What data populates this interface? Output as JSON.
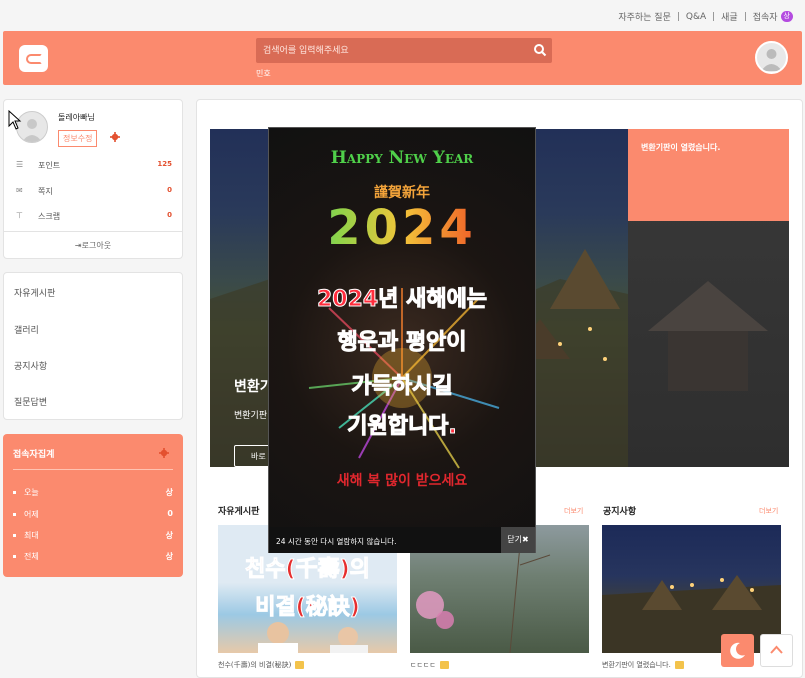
{
  "toplinks": {
    "faq": "자주하는 질문",
    "qa": "Q&A",
    "new": "새글",
    "visitors": "접속자",
    "visitors_badge": "상"
  },
  "header": {
    "search_placeholder": "검색어를 입력해주세요",
    "popular": "민호"
  },
  "profile": {
    "name": "돌레아빠님",
    "edit_label": "정보수정",
    "rows": [
      {
        "icon": "database-icon",
        "label": "포인트",
        "value": "125"
      },
      {
        "icon": "mail-icon",
        "label": "쪽지",
        "value": "0"
      },
      {
        "icon": "pin-icon",
        "label": "스크랩",
        "value": "0"
      }
    ],
    "logout": "로그아웃"
  },
  "menu": {
    "items": [
      "자유게시판",
      "갤러리",
      "공지사항",
      "질문답변"
    ]
  },
  "visitors": {
    "title": "접속자집계",
    "rows": [
      {
        "label": "오늘",
        "value": "상"
      },
      {
        "label": "어제",
        "value": "0"
      },
      {
        "label": "최대",
        "value": "상"
      },
      {
        "label": "전체",
        "value": "상"
      }
    ]
  },
  "hero": {
    "title": "변환기",
    "subtitle": "변환기판",
    "button": "바로",
    "side_text": "변환기판이 열렸습니다."
  },
  "sections": {
    "free_board": "자유게시판",
    "notice": "공지사항",
    "more1": "더보기",
    "more2": "더보기",
    "captions": [
      "천수(千壽)의 비결(秘訣)",
      "ㄷㄷㄷㄷ",
      "변환기판이 열렸습니다."
    ],
    "thumb1_text1": "천수(千壽)의",
    "thumb1_text2": "비결(秘訣)"
  },
  "popup": {
    "line1": "Happy New Year",
    "line2": "謹賀新年",
    "year": "2024",
    "msg1": "2024년 새해에는",
    "msg2": "행운과 평안이",
    "msg3": "가득하시길",
    "msg4": "기원합니다.",
    "msg5": "새해 복 많이 받으세요",
    "footer": "24 시간 동안 다시 열람하지 않습니다.",
    "close": "닫기"
  },
  "colors": {
    "accent": "#fb8a6e",
    "accent_dark": "#d96b55",
    "value_red": "#e3502f"
  }
}
